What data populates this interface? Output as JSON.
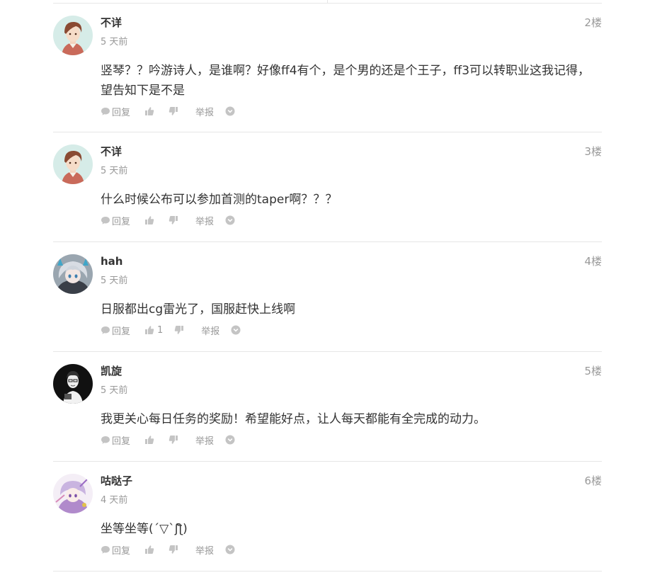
{
  "comments": [
    {
      "username": "不详",
      "time": "5 天前",
      "floor": "2楼",
      "content": "竖琴？？吟游诗人，是谁啊？好像ff4有个，是个男的还是个王子，ff3可以转职业这我记得，望告知下是不是",
      "like_count": "",
      "avatar_icon": "anime-boy-avatar"
    },
    {
      "username": "不详",
      "time": "5 天前",
      "floor": "3楼",
      "content": "什么时候公布可以参加首测的taper啊？？？",
      "like_count": "",
      "avatar_icon": "anime-boy-avatar"
    },
    {
      "username": "hah",
      "time": "5 天前",
      "floor": "4楼",
      "content": "日服都出cg雷光了，国服赶快上线啊",
      "like_count": "1",
      "avatar_icon": "anime-girl-avatar"
    },
    {
      "username": "凯旋",
      "time": "5 天前",
      "floor": "5楼",
      "content": "我更关心每日任务的奖励！希望能好点，让人每天都能有全完成的动力。",
      "like_count": "",
      "avatar_icon": "sketch-portrait-avatar"
    },
    {
      "username": "咕哒子",
      "time": "4 天前",
      "floor": "6楼",
      "content": "坐等坐等(´▽`ʃƪ)",
      "like_count": "",
      "avatar_icon": "purple-character-avatar"
    }
  ],
  "actions": {
    "reply_label": "回复",
    "report_label": "举报"
  },
  "colors": {
    "text": "#333333",
    "muted": "#999999",
    "icon": "#c4c4c4",
    "divider": "#e6e6e6"
  }
}
